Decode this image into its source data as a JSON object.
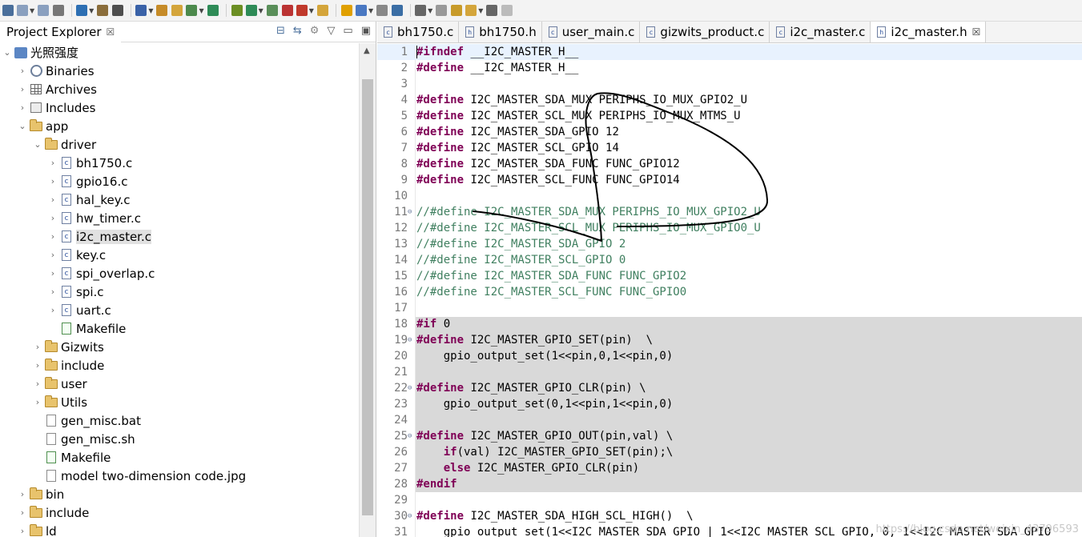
{
  "toolbar": {
    "buttons": [
      "new-icon",
      "save-icon",
      "save-all-icon",
      "print-icon",
      "settings-icon",
      "build-icon",
      "binary-icon",
      "pin-icon",
      "new-class-icon",
      "new-folder-icon",
      "new-file-icon",
      "refresh-icon",
      "debug-icon",
      "run-icon",
      "run-config-icon",
      "stop-icon",
      "external-icon",
      "open-icon",
      "search-icon",
      "highlight-icon",
      "link-icon",
      "toggle-icon",
      "paragraph-icon",
      "next-annotation-icon",
      "prev-annotation-icon",
      "last-edit-icon",
      "back-icon",
      "forward-icon"
    ]
  },
  "project_explorer": {
    "title": "Project Explorer",
    "close_glyph": "☒",
    "tree": [
      {
        "label": "光照强度",
        "level": 0,
        "twisty": "v",
        "icon": "project"
      },
      {
        "label": "Binaries",
        "level": 1,
        "twisty": ">",
        "icon": "binaries"
      },
      {
        "label": "Archives",
        "level": 1,
        "twisty": ">",
        "icon": "archives"
      },
      {
        "label": "Includes",
        "level": 1,
        "twisty": ">",
        "icon": "includes"
      },
      {
        "label": "app",
        "level": 1,
        "twisty": "v",
        "icon": "folder"
      },
      {
        "label": "driver",
        "level": 2,
        "twisty": "v",
        "icon": "folder"
      },
      {
        "label": "bh1750.c",
        "level": 3,
        "twisty": ">",
        "icon": "cfile"
      },
      {
        "label": "gpio16.c",
        "level": 3,
        "twisty": ">",
        "icon": "cfile"
      },
      {
        "label": "hal_key.c",
        "level": 3,
        "twisty": ">",
        "icon": "cfile"
      },
      {
        "label": "hw_timer.c",
        "level": 3,
        "twisty": ">",
        "icon": "cfile"
      },
      {
        "label": "i2c_master.c",
        "level": 3,
        "twisty": ">",
        "icon": "cfile",
        "selected": true
      },
      {
        "label": "key.c",
        "level": 3,
        "twisty": ">",
        "icon": "cfile"
      },
      {
        "label": "spi_overlap.c",
        "level": 3,
        "twisty": ">",
        "icon": "cfile"
      },
      {
        "label": "spi.c",
        "level": 3,
        "twisty": ">",
        "icon": "cfile"
      },
      {
        "label": "uart.c",
        "level": 3,
        "twisty": ">",
        "icon": "cfile"
      },
      {
        "label": "Makefile",
        "level": 3,
        "twisty": "",
        "icon": "make"
      },
      {
        "label": "Gizwits",
        "level": 2,
        "twisty": ">",
        "icon": "folder"
      },
      {
        "label": "include",
        "level": 2,
        "twisty": ">",
        "icon": "folder"
      },
      {
        "label": "user",
        "level": 2,
        "twisty": ">",
        "icon": "folder"
      },
      {
        "label": "Utils",
        "level": 2,
        "twisty": ">",
        "icon": "folder"
      },
      {
        "label": "gen_misc.bat",
        "level": 2,
        "twisty": "",
        "icon": "file"
      },
      {
        "label": "gen_misc.sh",
        "level": 2,
        "twisty": "",
        "icon": "file"
      },
      {
        "label": "Makefile",
        "level": 2,
        "twisty": "",
        "icon": "make"
      },
      {
        "label": "model two-dimension code.jpg",
        "level": 2,
        "twisty": "",
        "icon": "file"
      },
      {
        "label": "bin",
        "level": 1,
        "twisty": ">",
        "icon": "folder"
      },
      {
        "label": "include",
        "level": 1,
        "twisty": ">",
        "icon": "folder"
      },
      {
        "label": "ld",
        "level": 1,
        "twisty": ">",
        "icon": "folder"
      }
    ]
  },
  "editor": {
    "tabs": [
      {
        "label": "bh1750.c",
        "active": false
      },
      {
        "label": "bh1750.h",
        "active": false
      },
      {
        "label": "user_main.c",
        "active": false
      },
      {
        "label": "gizwits_product.c",
        "active": false
      },
      {
        "label": "i2c_master.c",
        "active": false
      },
      {
        "label": "i2c_master.h",
        "active": true
      }
    ],
    "tab_close_glyph": "☒",
    "lines": [
      {
        "n": "1",
        "kw": "#ifndef",
        "rest": " __I2C_MASTER_H__",
        "hl": true
      },
      {
        "n": "2",
        "kw": "#define",
        "rest": " __I2C_MASTER_H__"
      },
      {
        "n": "3",
        "kw": "",
        "rest": ""
      },
      {
        "n": "4",
        "kw": "#define",
        "rest": " I2C_MASTER_SDA_MUX PERIPHS_IO_MUX_GPIO2_U"
      },
      {
        "n": "5",
        "kw": "#define",
        "rest": " I2C_MASTER_SCL_MUX PERIPHS_IO_MUX_MTMS_U"
      },
      {
        "n": "6",
        "kw": "#define",
        "rest": " I2C_MASTER_SDA_GPIO 12"
      },
      {
        "n": "7",
        "kw": "#define",
        "rest": " I2C_MASTER_SCL_GPIO 14"
      },
      {
        "n": "8",
        "kw": "#define",
        "rest": " I2C_MASTER_SDA_FUNC FUNC_GPIO12"
      },
      {
        "n": "9",
        "kw": "#define",
        "rest": " I2C_MASTER_SCL_FUNC FUNC_GPIO14"
      },
      {
        "n": "10",
        "kw": "",
        "rest": ""
      },
      {
        "n": "11",
        "fold": "⊖",
        "comment": "//#define I2C_MASTER_SDA_MUX PERIPHS_IO_MUX_GPIO2_U"
      },
      {
        "n": "12",
        "comment": "//#define I2C_MASTER_SCL_MUX PERIPHS_IO_MUX_GPIO0_U"
      },
      {
        "n": "13",
        "comment": "//#define I2C_MASTER_SDA_GPIO 2"
      },
      {
        "n": "14",
        "comment": "//#define I2C_MASTER_SCL_GPIO 0"
      },
      {
        "n": "15",
        "comment": "//#define I2C_MASTER_SDA_FUNC FUNC_GPIO2"
      },
      {
        "n": "16",
        "comment": "//#define I2C_MASTER_SCL_FUNC FUNC_GPIO0"
      },
      {
        "n": "17",
        "kw": "",
        "rest": ""
      },
      {
        "n": "18",
        "kw": "#if",
        "rest": " 0",
        "inactive": true
      },
      {
        "n": "19",
        "fold": "⊖",
        "kw": "#define",
        "rest": " I2C_MASTER_GPIO_SET(pin)  \\",
        "inactive": true
      },
      {
        "n": "20",
        "kw": "",
        "rest": "    gpio_output_set(1<<pin,0,1<<pin,0)",
        "inactive": true
      },
      {
        "n": "21",
        "kw": "",
        "rest": "",
        "inactive": true
      },
      {
        "n": "22",
        "fold": "⊖",
        "kw": "#define",
        "rest": " I2C_MASTER_GPIO_CLR(pin) \\",
        "inactive": true
      },
      {
        "n": "23",
        "kw": "",
        "rest": "    gpio_output_set(0,1<<pin,1<<pin,0)",
        "inactive": true
      },
      {
        "n": "24",
        "kw": "",
        "rest": "",
        "inactive": true
      },
      {
        "n": "25",
        "fold": "⊖",
        "kw": "#define",
        "rest": " I2C_MASTER_GPIO_OUT(pin,val) \\",
        "inactive": true
      },
      {
        "n": "26",
        "pre": "    ",
        "kw": "if",
        "rest": "(val) I2C_MASTER_GPIO_SET(pin);\\",
        "inactive": true
      },
      {
        "n": "27",
        "pre": "    ",
        "kw": "else",
        "rest": " I2C_MASTER_GPIO_CLR(pin)",
        "inactive": true
      },
      {
        "n": "28",
        "kw": "#endif",
        "rest": "",
        "inactive": true
      },
      {
        "n": "29",
        "kw": "",
        "rest": ""
      },
      {
        "n": "30",
        "fold": "⊖",
        "kw": "#define",
        "rest": " I2C_MASTER_SDA_HIGH_SCL_HIGH()  \\"
      },
      {
        "n": "31",
        "kw": "",
        "rest": "    gpio_output_set(1<<I2C_MASTER_SDA_GPIO | 1<<I2C_MASTER_SCL_GPIO, 0, 1<<I2C_MASTER_SDA_GPIO"
      }
    ],
    "watermark": "https://blog.csdn.net/weixin_43796593"
  }
}
